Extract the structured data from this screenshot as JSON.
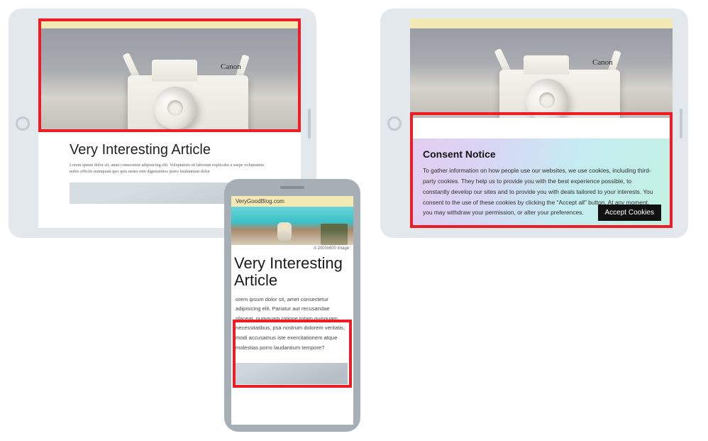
{
  "tablet_left": {
    "hero_brand": "Canon",
    "article_title": "Very Interesting Article",
    "article_body": "Lorem ipsum dolor sit, amet consectetur adipisicing elit. Voluptatum sit laborum explicabo a saepe voluptatem nobis officiis numquam quo quis nemo rem dignissimos porro laudantium dolor"
  },
  "tablet_right": {
    "hero_brand": "Canon",
    "consent_title": "Consent Notice",
    "consent_body": "To gather information on how people use our websites, we use cookies, including third-party cookies. They help us to provide you with the best experience possible, to constantly develop our sites and to provide you with deals tailored to your interests. You consent to the use of these cookies by clicking the \"Accept all\" button. At any moment, you may withdraw your permission, or alter your preferences.",
    "accept_label": "Accept Cookies"
  },
  "phone": {
    "site_name": "VeryGoodBlog.com",
    "image_caption": "A 2000x600 image",
    "article_title": "Very Interesting Article",
    "article_body": "orem ipsum dolor sit, amet consectetur adipisicing elit. Pariatur aut recusandae placeat, numquam ratione totam quisquam necessitatibus, psa nostrum dolorem veritatis, modi accusamus iste exercitationem atque molestias porro laudantium tempore?"
  }
}
